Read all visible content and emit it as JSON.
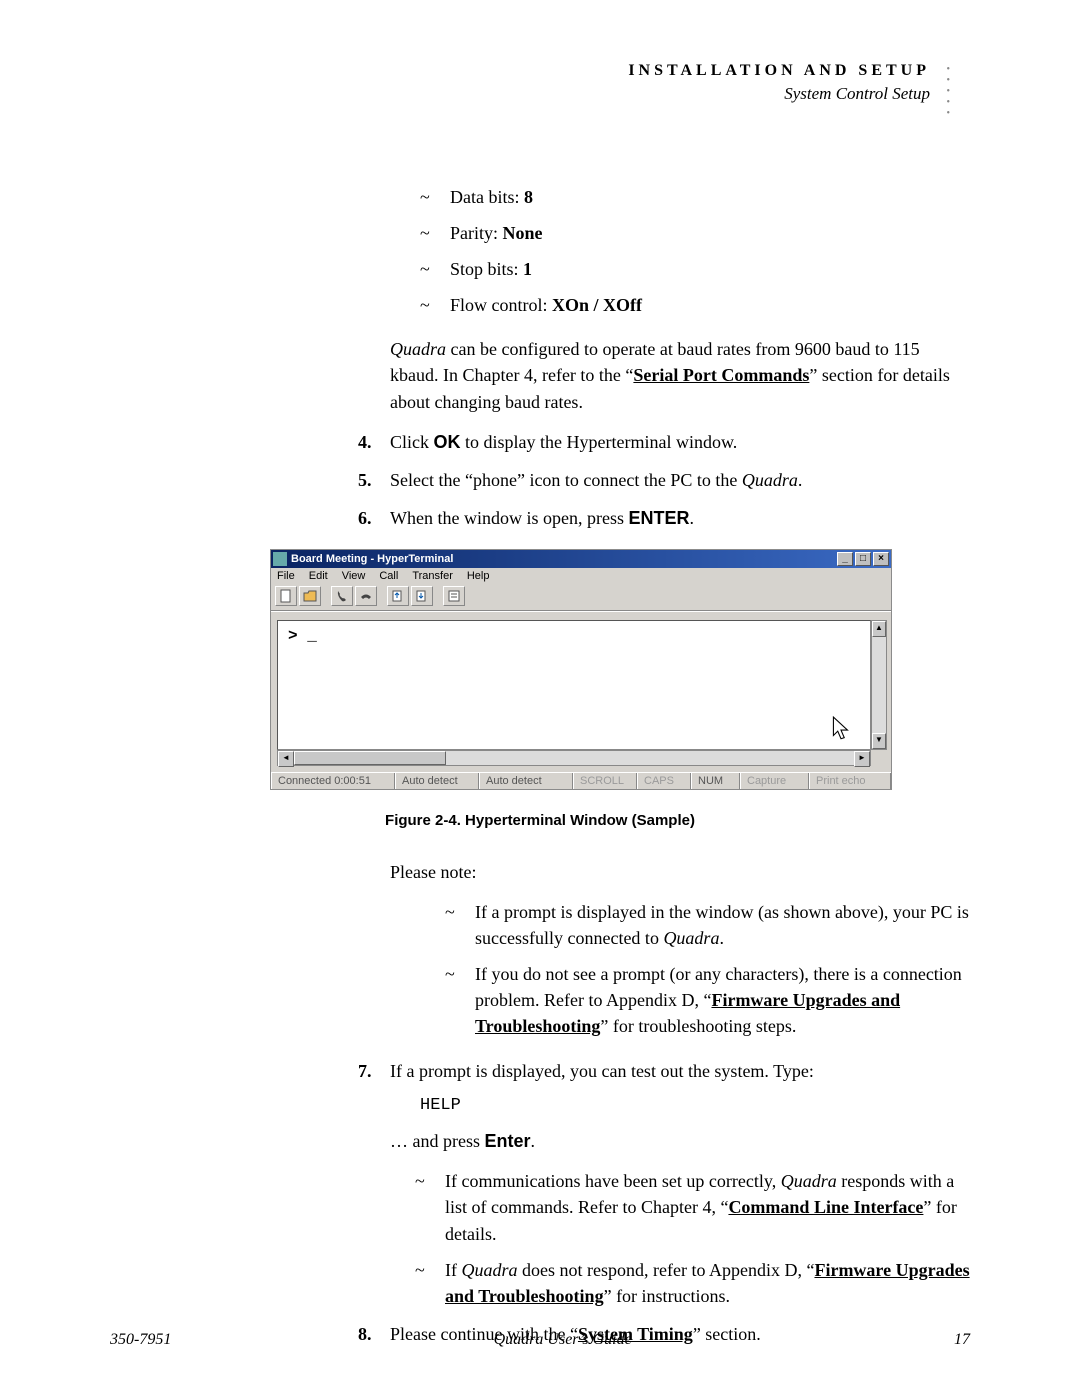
{
  "header": {
    "title": "INSTALLATION AND SETUP",
    "subtitle": "System Control Setup"
  },
  "settings": [
    {
      "label": "Data bits:",
      "value": "8"
    },
    {
      "label": "Parity:",
      "value": "None"
    },
    {
      "label": "Stop bits:",
      "value": "1"
    },
    {
      "label": "Flow control:",
      "value": "XOn / XOff"
    }
  ],
  "paragraph1": {
    "pre": "Quadra",
    "mid": " can be configured to operate at baud rates from 9600 baud to 115 kbaud.  In Chapter 4, refer to the “",
    "link": "Serial Port Commands",
    "post": "” section for details about changing baud rates."
  },
  "steps_a": [
    {
      "n": "4.",
      "text_pre": "Click ",
      "bold": "OK",
      "text_post": " to display the Hyperterminal window."
    },
    {
      "n": "5.",
      "text_pre": "Select the “phone” icon to connect the PC to the ",
      "italic": "Quadra",
      "text_post": "."
    },
    {
      "n": "6.",
      "text_pre": "When the window is open, press ",
      "bold": "ENTER",
      "text_post": "."
    }
  ],
  "figure": {
    "caption": "Figure 2-4.  Hyperterminal Window (Sample)",
    "window_title": "Board Meeting - HyperTerminal",
    "menus": [
      "File",
      "Edit",
      "View",
      "Call",
      "Transfer",
      "Help"
    ],
    "prompt": "> _",
    "status": {
      "connected": "Connected 0:00:51",
      "detect1": "Auto detect",
      "detect2": "Auto detect",
      "scroll": "SCROLL",
      "caps": "CAPS",
      "num": "NUM",
      "capture": "Capture",
      "print": "Print echo"
    }
  },
  "please_note": "Please note:",
  "notes": [
    {
      "pre": "If a prompt is displayed in the window (as shown above), your PC is successfully connected to ",
      "italic": "Quadra",
      "post": "."
    },
    {
      "pre": "If you do not see a prompt (or any characters), there is a connection problem.  Refer to Appendix D, “",
      "link": "Firmware Upgrades and Troubleshooting",
      "post": "” for troubleshooting steps."
    }
  ],
  "step7": {
    "n": "7.",
    "text": "If a prompt is displayed, you can test out the system.  Type:",
    "code": "HELP",
    "and_press": "… and press ",
    "enter": "Enter",
    "dot": "."
  },
  "notes2": [
    {
      "pre": "If communications have been set up correctly, ",
      "italic": "Quadra",
      "mid": " responds with a list of commands.  Refer to Chapter 4, “",
      "link": "Command Line Interface",
      "post": "” for details."
    },
    {
      "pre": "If ",
      "italic": "Quadra",
      "mid": " does not respond, refer to Appendix D, “",
      "link": "Firmware Upgrades and Troubleshooting",
      "post": "” for instructions."
    }
  ],
  "step8": {
    "n": "8.",
    "pre": "Please continue with the “",
    "link": "System Timing",
    "post": "” section."
  },
  "footer": {
    "left": "350-7951",
    "center": "Quadra User’s Guide",
    "right": "17"
  }
}
